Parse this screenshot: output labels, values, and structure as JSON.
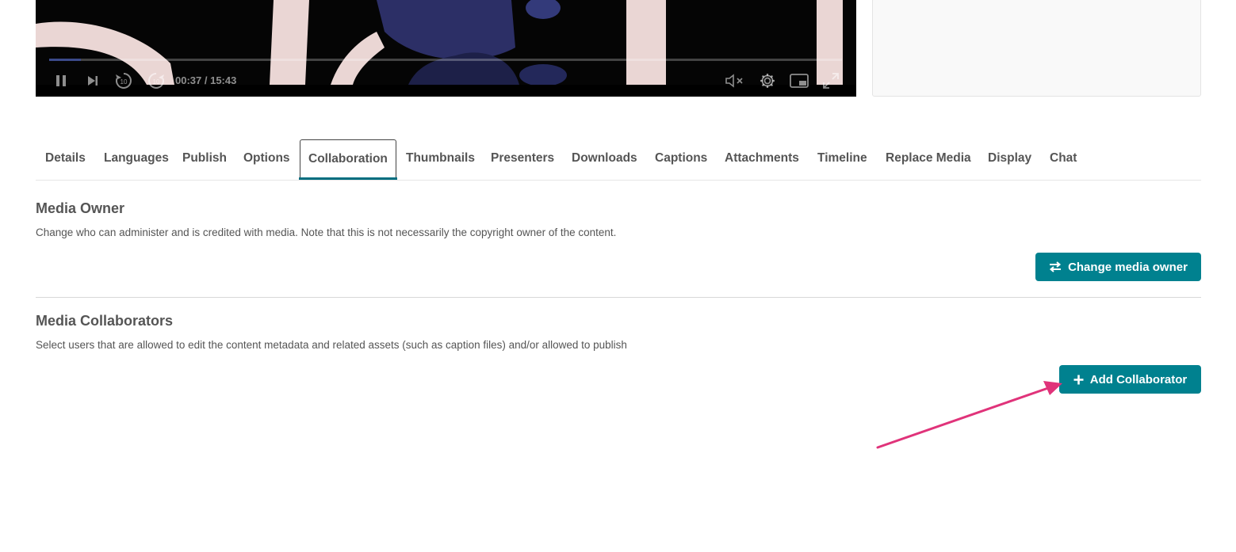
{
  "player": {
    "time_display": "00:37 / 15:43",
    "progress_fraction": 0.04,
    "controls": [
      "pause-icon",
      "next-icon",
      "rewind-10-icon",
      "forward-10-icon",
      "mute-icon",
      "gear-icon",
      "picture-in-picture-icon",
      "fullscreen-icon"
    ],
    "skip_seconds": "10"
  },
  "tabs": [
    {
      "label": "Details"
    },
    {
      "label": "Languages"
    },
    {
      "label": "Publish"
    },
    {
      "label": "Options"
    },
    {
      "label": "Collaboration",
      "active": true
    },
    {
      "label": "Thumbnails"
    },
    {
      "label": "Presenters"
    },
    {
      "label": "Downloads"
    },
    {
      "label": "Captions"
    },
    {
      "label": "Attachments"
    },
    {
      "label": "Timeline"
    },
    {
      "label": "Replace Media"
    },
    {
      "label": "Display"
    },
    {
      "label": "Chat"
    }
  ],
  "media_owner": {
    "title": "Media Owner",
    "description": "Change who can administer and is credited with media. Note that this is not necessarily the copyright owner of the content.",
    "button_label": "Change media owner",
    "button_icon": "swap-arrows-icon"
  },
  "media_collaborators": {
    "title": "Media Collaborators",
    "description": "Select users that are allowed to edit the content metadata and related assets (such as caption files) and/or allowed to publish",
    "button_label": "Add Collaborator",
    "button_icon": "plus-icon"
  },
  "colors": {
    "accent": "#00818f",
    "active_tab_underline": "#006e7f",
    "annotation_arrow": "#e0337a"
  }
}
